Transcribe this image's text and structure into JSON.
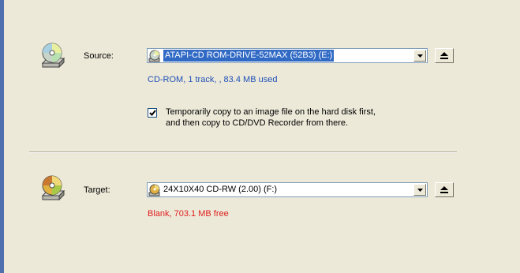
{
  "source": {
    "label": "Source:",
    "drive": "ATAPI-CD ROM-DRIVE-52MAX (52B3) (E:)",
    "info": "CD-ROM, 1 track, , 83.4 MB used",
    "icon": "cd-drive-icon"
  },
  "copy_option": {
    "checked": true,
    "line1": "Temporarily copy to an image file on the hard disk first,",
    "line2": "and then copy to CD/DVD Recorder from there."
  },
  "target": {
    "label": "Target:",
    "drive": "24X10X40 CD-RW (2.00) (F:)",
    "info": "Blank, 703.1 MB free",
    "icon": "cd-burner-icon"
  },
  "colors": {
    "selection": "#316ac5",
    "source_info": "#1f4fb8",
    "target_info": "#e02020",
    "border": "#4f6fae"
  }
}
